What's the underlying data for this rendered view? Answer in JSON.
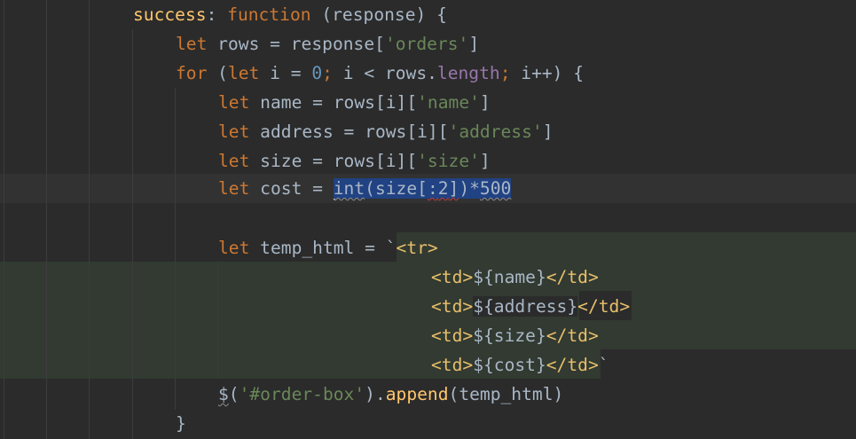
{
  "editor": {
    "lines": [
      {
        "id": "success",
        "parts": [
          {
            "t": "success",
            "c": "prop"
          },
          {
            "t": ": ",
            "c": "plain"
          },
          {
            "t": "function",
            "c": "kw"
          },
          {
            "t": " (response) {",
            "c": "plain"
          }
        ]
      },
      {
        "id": "rows",
        "parts": [
          {
            "t": "let",
            "c": "kw"
          },
          {
            "t": " rows = response[",
            "c": "plain"
          },
          {
            "t": "'orders'",
            "c": "str"
          },
          {
            "t": "]",
            "c": "plain"
          }
        ]
      },
      {
        "id": "for",
        "parts": [
          {
            "t": "for",
            "c": "kw"
          },
          {
            "t": " (",
            "c": "plain"
          },
          {
            "t": "let",
            "c": "kw"
          },
          {
            "t": " i = ",
            "c": "plain"
          },
          {
            "t": "0",
            "c": "num"
          },
          {
            "t": ";",
            "c": "kw"
          },
          {
            "t": " i < rows.",
            "c": "plain"
          },
          {
            "t": "length",
            "c": "fld"
          },
          {
            "t": ";",
            "c": "kw"
          },
          {
            "t": " i++) {",
            "c": "plain"
          }
        ]
      },
      {
        "id": "name",
        "parts": [
          {
            "t": "let",
            "c": "kw"
          },
          {
            "t": " name = rows[i][",
            "c": "plain"
          },
          {
            "t": "'name'",
            "c": "str"
          },
          {
            "t": "]",
            "c": "plain"
          }
        ]
      },
      {
        "id": "address",
        "parts": [
          {
            "t": "let",
            "c": "kw"
          },
          {
            "t": " address = rows[i][",
            "c": "plain"
          },
          {
            "t": "'address'",
            "c": "str"
          },
          {
            "t": "]",
            "c": "plain"
          }
        ]
      },
      {
        "id": "size",
        "parts": [
          {
            "t": "let",
            "c": "kw"
          },
          {
            "t": " size = rows[i][",
            "c": "plain"
          },
          {
            "t": "'size'",
            "c": "str"
          },
          {
            "t": "]",
            "c": "plain"
          }
        ]
      },
      {
        "id": "cost",
        "parts": [
          {
            "t": "let",
            "c": "kw"
          },
          {
            "t": " cost = ",
            "c": "plain"
          },
          {
            "t": "",
            "c": "caret"
          },
          {
            "t": "int",
            "c": "sel weak-underline"
          },
          {
            "t": "(size[",
            "c": "sel"
          },
          {
            "t": ":",
            "c": "sel err-underline"
          },
          {
            "t": "2",
            "c": "sel num err-underline"
          },
          {
            "t": "]",
            "c": "sel err-underline"
          },
          {
            "t": ")*",
            "c": "sel"
          },
          {
            "t": "500",
            "c": "sel num weak-underline"
          }
        ]
      },
      {
        "id": "blank",
        "parts": []
      },
      {
        "id": "temp",
        "parts": [
          {
            "t": "let",
            "c": "kw"
          },
          {
            "t": " temp_html = `",
            "c": "plain"
          },
          {
            "t": "<tr>",
            "c": "tag"
          }
        ]
      },
      {
        "id": "td-name",
        "parts": [
          {
            "t": "<td>",
            "c": "tag"
          },
          {
            "t": "${name}",
            "c": "plain"
          },
          {
            "t": "</td>",
            "c": "tag"
          }
        ]
      },
      {
        "id": "td-address",
        "parts": [
          {
            "t": "<td>",
            "c": "tag"
          },
          {
            "t": "${address}",
            "c": "plain dollar-bg"
          },
          {
            "t": "</td>",
            "c": "tag"
          }
        ]
      },
      {
        "id": "td-size",
        "parts": [
          {
            "t": "<td>",
            "c": "tag"
          },
          {
            "t": "${size}",
            "c": "plain"
          },
          {
            "t": "</td>",
            "c": "tag"
          }
        ]
      },
      {
        "id": "td-cost",
        "parts": [
          {
            "t": "<td>",
            "c": "tag"
          },
          {
            "t": "${cost}",
            "c": "plain"
          },
          {
            "t": "</td>",
            "c": "tag"
          },
          {
            "t": "`",
            "c": "plain"
          }
        ]
      },
      {
        "id": "append",
        "parts": [
          {
            "t": "$",
            "c": "plain weak-underline"
          },
          {
            "t": "(",
            "c": "plain"
          },
          {
            "t": "'#order-box'",
            "c": "str"
          },
          {
            "t": ").",
            "c": "plain"
          },
          {
            "t": "append",
            "c": "prop"
          },
          {
            "t": "(temp_html)",
            "c": "plain"
          }
        ]
      },
      {
        "id": "close-for",
        "parts": [
          {
            "t": "}",
            "c": "plain"
          }
        ]
      }
    ]
  }
}
